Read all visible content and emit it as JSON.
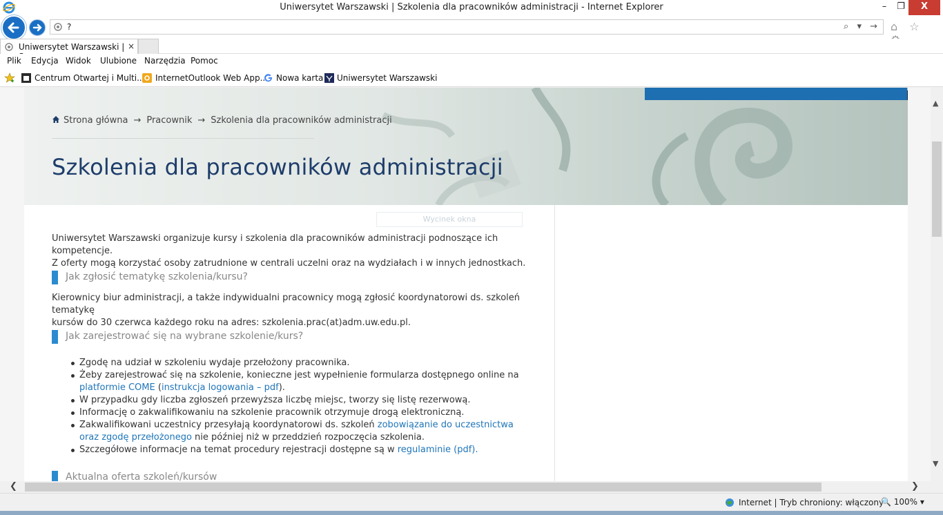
{
  "window": {
    "title": "Uniwersytet Warszawski | Szkolenia dla pracowników administracji - Internet Explorer",
    "minimize": "–",
    "maximize": "❐",
    "close": "X"
  },
  "addressbar": {
    "url": "?",
    "tools": "⌕ ▾ →",
    "nav_right": "⌂ ☆ ⚙"
  },
  "tabs": [
    {
      "label": "Uniwersytet Warszawski | Sz...",
      "close": "×"
    }
  ],
  "menu": {
    "items": [
      "Plik",
      "Edycja",
      "Widok",
      "Ulubione",
      "Narzędzia",
      "Pomoc"
    ]
  },
  "favorites": {
    "items": [
      "Centrum Otwartej i Multi...",
      "InternetOutlook Web App...",
      "Nowa karta",
      "Uniwersytet Warszawski"
    ]
  },
  "page": {
    "breadcrumb": [
      "Strona główna",
      "Pracownik",
      "Szkolenia dla pracowników administracji"
    ],
    "breadcrumb_sep": "→",
    "title": "Szkolenia dla pracowników administracji",
    "snip_overlay": "Wycinek okna",
    "intro_1": "Uniwersytet Warszawski organizuje kursy i szkolenia dla pracowników administracji podnoszące ich kompetencje.",
    "intro_2": "Z oferty mogą korzystać osoby zatrudnione w centrali uczelni oraz na wydziałach i w innych jednostkach.",
    "heading_1": "Jak zgłosić tematykę szkolenia/kursu?",
    "para_2a": "Kierownicy biur administracji, a także indywidualni pracownicy mogą zgłosić koordynatorowi ds. szkoleń tematykę",
    "para_2b": "kursów do 30 czerwca każdego roku na adres: szkolenia.prac(at)adm.uw.edu.pl.",
    "heading_2": "Jak zarejestrować się na wybrane szkolenie/kurs?",
    "bullets": {
      "b1": "Zgodę na udział w szkoleniu wydaje przełożony pracownika.",
      "b2_pre": "Żeby zarejestrować się na szkolenie, konieczne jest wypełnienie formularza dostępnego online na",
      "b2_link1": "platformie COME",
      "b2_mid": " (",
      "b2_link2": "instrukcja logowania – pdf",
      "b2_post": ").",
      "b3": "W przypadku gdy liczba zgłoszeń przewyższa liczbę miejsc, tworzy się listę rezerwową.",
      "b4": "Informację o zakwalifikowaniu na szkolenie pracownik otrzymuje drogą elektroniczną.",
      "b5_pre": "Zakwalifikowani uczestnicy przesyłają koordynatorowi ds. szkoleń ",
      "b5_link1": "zobowiązanie do uczestnictwa",
      "b5_link2": "oraz zgodę przełożonego",
      "b5_post": " nie później niż w przeddzień rozpoczęcia szkolenia.",
      "b6_pre": "Szczegółowe informacje na temat procedury rejestracji dostępne są w ",
      "b6_link": "regulaminie (pdf)."
    },
    "heading_3": "Aktualna oferta szkoleń/kursów"
  },
  "scrollbars": {
    "up": "▲",
    "down": "▼",
    "left": "❮",
    "right": "❯"
  },
  "status": {
    "zone": "Internet | Tryb chroniony: włączony",
    "zoom": "🔍 100% ▾"
  },
  "colors": {
    "accent": "#1d6fb1",
    "title_color": "#1e3d6b",
    "link": "#1e75b9",
    "heading_bar": "#2a8bd0"
  }
}
